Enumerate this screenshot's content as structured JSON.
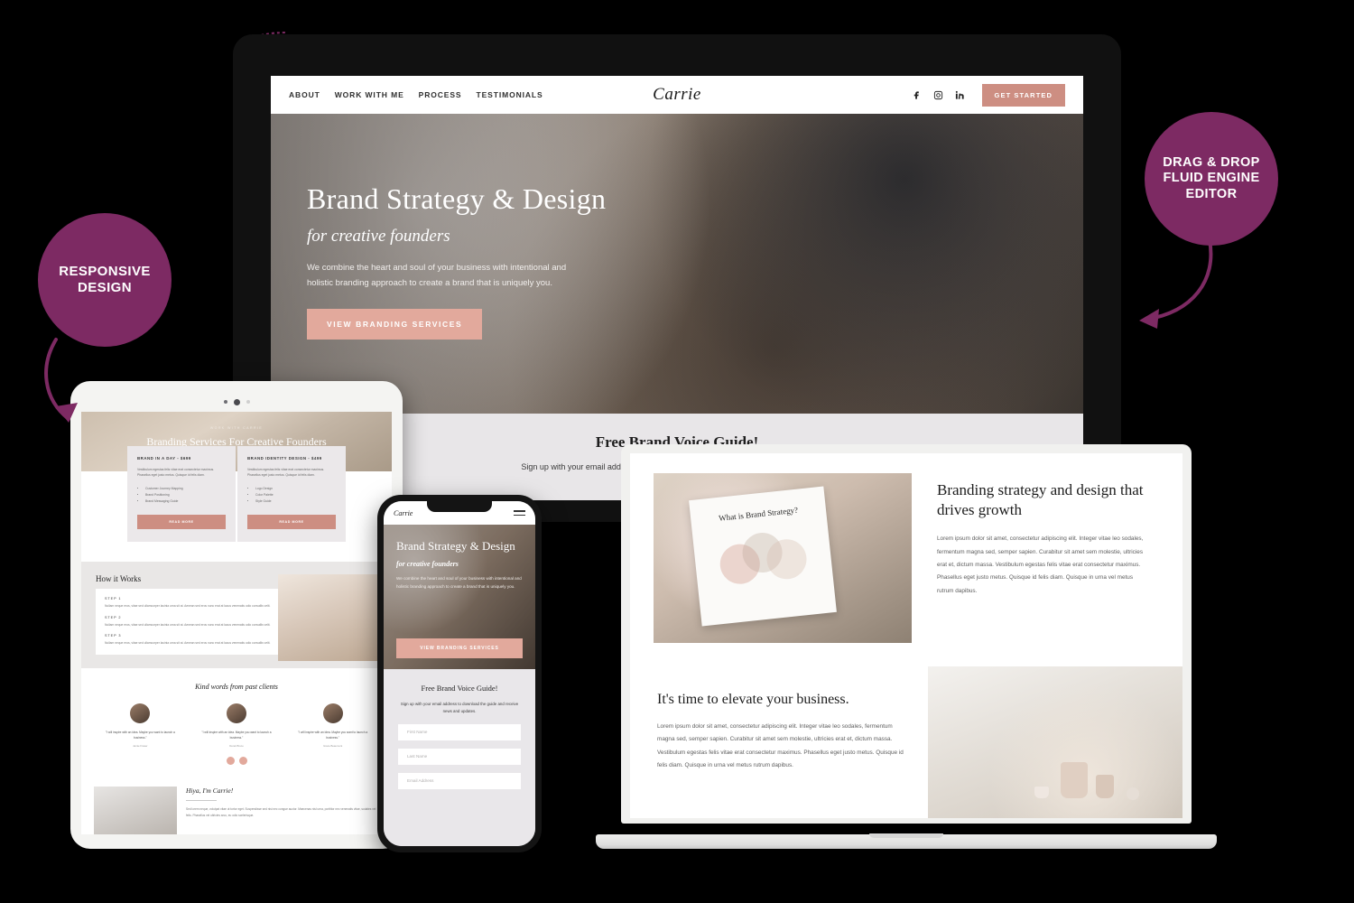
{
  "badges": {
    "left": "RESPONSIVE DESIGN",
    "right": "DRAG & DROP FLUID ENGINE EDITOR"
  },
  "site": {
    "brand": "Carrie",
    "nav": [
      "ABOUT",
      "WORK WITH ME",
      "PROCESS",
      "TESTIMONIALS"
    ],
    "social": [
      "facebook-icon",
      "instagram-icon",
      "linkedin-icon"
    ],
    "cta": "GET STARTED",
    "hero": {
      "title": "Brand Strategy & Design",
      "subtitle": "for creative founders",
      "body": "We combine the heart and soul of your business with intentional and holistic branding approach to create a brand that is uniquely you.",
      "button": "VIEW BRANDING SERVICES"
    },
    "optin": {
      "title": "Free Brand Voice Guide!",
      "body": "Sign up with your email address to download the guide and receive news and updates.",
      "fields": [
        "First Name",
        "Last Name",
        "Email Address"
      ]
    }
  },
  "tablet": {
    "hero_eyebrow": "WORK WITH CARRIE",
    "hero_title": "Branding Services For Creative Founders",
    "cards": [
      {
        "title": "BRAND IN A DAY - $699",
        "body": "Vestibulum egestas felis vitae erat consectetur maximus. Phasellus eget justo metus. Quisque id felis diam.",
        "items": [
          "Customer Journey Mapping",
          "Brand Positioning",
          "Brand Messaging Guide"
        ],
        "button": "READ MORE"
      },
      {
        "title": "BRAND IDENTITY DESIGN - $499",
        "body": "Vestibulum egestas felis vitae erat consectetur maximus. Phasellus eget justo metus. Quisque id felis diam.",
        "items": [
          "Logo Design",
          "Color Palette",
          "Style Guide"
        ],
        "button": "READ MORE"
      }
    ],
    "works_title": "How it Works",
    "steps": [
      {
        "label": "STEP 1",
        "body": "Nullam neque eros, vitae sed ullamcorper lacinia urna sit at. Aenean sed eros nunc erat at lacus venenatis odio convallis velit."
      },
      {
        "label": "STEP 2",
        "body": "Nullam neque eros, vitae sed ullamcorper lacinia urna sit at. Aenean sed eros nunc erat at lacus venenatis odio convallis velit."
      },
      {
        "label": "STEP 3",
        "body": "Nullam neque eros, vitae sed ullamcorper lacinia urna sit at. Aenean sed eros nunc erat at lacus venenatis odio convallis velit."
      }
    ],
    "testimonials_title": "Kind words from past clients",
    "testimonials": [
      {
        "quote": "\"I will inspire with an idea. Maybe you want to launch a business.\"",
        "name": "Jamie Fraser"
      },
      {
        "quote": "\"I will inspire with an idea. Maybe you want to launch a business.\"",
        "name": "Derek Bruce"
      },
      {
        "quote": "\"I will inspire with an idea. Maybe you want to launch a business.\"",
        "name": "Grace Beaumont"
      }
    ],
    "about_title": "Hiya, I'm Carrie!",
    "about_body": "Sed lorem neque, volutpat vitae ut tortor eget. Suspendisse sed nisi nec congue auctor. Maecenas nisl urna, porttitor nec venenatis vitae, sodales vel felis. Phasellus vel ultricies arcu, eu odio scelerisque."
  },
  "laptop": {
    "clipboard_title": "What is Brand Strategy?",
    "section1_title": "Branding strategy and design that drives growth",
    "section1_body": "Lorem ipsum dolor sit amet, consectetur adipiscing elit. Integer vitae leo sodales, fermentum magna sed, semper sapien. Curabitur sit amet sem molestie, ultricies erat et, dictum massa. Vestibulum egestas felis vitae erat consectetur maximus. Phasellus eget justo metus. Quisque id felis diam. Quisque in urna vel metus rutrum dapibus.",
    "section2_title": "It's time to elevate your business.",
    "section2_body": "Lorem ipsum dolor sit amet, consectetur adipiscing elit. Integer vitae leo sodales, fermentum magna sed, semper sapien. Curabitur sit amet sem molestie, ultricies erat et, dictum massa. Vestibulum egestas felis vitae erat consectetur maximus. Phasellus eget justo metus. Quisque id felis diam. Quisque in urna vel metus rutrum dapibus."
  },
  "colors": {
    "badge_purple": "#7d2a63",
    "accent_salmon": "#cd8e82",
    "hero_button": "#e2a99c",
    "background": "#000000"
  }
}
